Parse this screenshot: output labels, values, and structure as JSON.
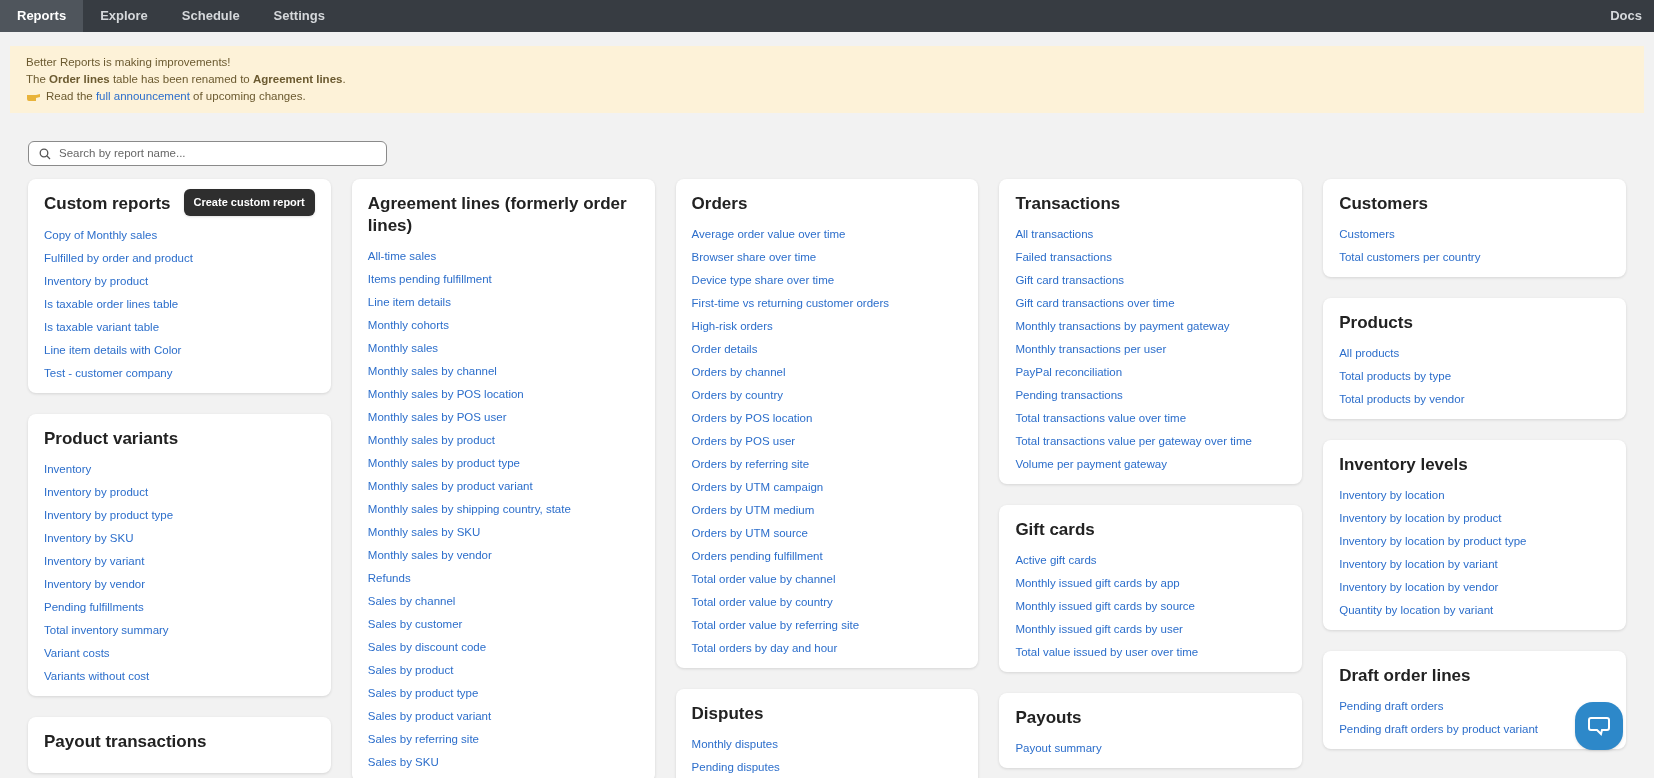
{
  "nav": {
    "tabs": [
      {
        "label": "Reports",
        "selected": true
      },
      {
        "label": "Explore",
        "selected": false
      },
      {
        "label": "Schedule",
        "selected": false
      },
      {
        "label": "Settings",
        "selected": false
      }
    ],
    "docs": "Docs"
  },
  "banner": {
    "line1": "Better Reports is making improvements!",
    "line2": "The **Order lines** table has been renamed to **Agreement lines**.",
    "line3_before": "Read the",
    "line3_link": "full announcement",
    "line3_after": "of upcoming changes."
  },
  "search": {
    "placeholder": "Search by report name..."
  },
  "columns": [
    [
      {
        "title": "Custom reports",
        "button": "Create custom report",
        "links": [
          "Copy of Monthly sales",
          "Fulfilled by order and product",
          "Inventory by product",
          "Is taxable order lines table",
          "Is taxable variant table",
          "Line item details with Color",
          "Test - customer company"
        ]
      },
      {
        "title": "Product variants",
        "links": [
          "Inventory",
          "Inventory by product",
          "Inventory by product type",
          "Inventory by SKU",
          "Inventory by variant",
          "Inventory by vendor",
          "Pending fulfillments",
          "Total inventory summary",
          "Variant costs",
          "Variants without cost"
        ]
      },
      {
        "title": "Payout transactions"
      }
    ],
    [
      {
        "title": "Agreement lines (formerly order lines)",
        "links": [
          "All-time sales",
          "Items pending fulfillment",
          "Line item details",
          "Monthly cohorts",
          "Monthly sales",
          "Monthly sales by channel",
          "Monthly sales by POS location",
          "Monthly sales by POS user",
          "Monthly sales by product",
          "Monthly sales by product type",
          "Monthly sales by product variant",
          "Monthly sales by shipping country, state",
          "Monthly sales by SKU",
          "Monthly sales by vendor",
          "Refunds",
          "Sales by channel",
          "Sales by customer",
          "Sales by discount code",
          "Sales by product",
          "Sales by product type",
          "Sales by product variant",
          "Sales by referring site",
          "Sales by SKU"
        ]
      }
    ],
    [
      {
        "title": "Orders",
        "links": [
          "Average order value over time",
          "Browser share over time",
          "Device type share over time",
          "First-time vs returning customer orders",
          "High-risk orders",
          "Order details",
          "Orders by channel",
          "Orders by country",
          "Orders by POS location",
          "Orders by POS user",
          "Orders by referring site",
          "Orders by UTM campaign",
          "Orders by UTM medium",
          "Orders by UTM source",
          "Orders pending fulfillment",
          "Total order value by channel",
          "Total order value by country",
          "Total order value by referring site",
          "Total orders by day and hour"
        ]
      },
      {
        "title": "Disputes",
        "links": [
          "Monthly disputes",
          "Pending disputes"
        ]
      }
    ],
    [
      {
        "title": "Transactions",
        "links": [
          "All transactions",
          "Failed transactions",
          "Gift card transactions",
          "Gift card transactions over time",
          "Monthly transactions by payment gateway",
          "Monthly transactions per user",
          "PayPal reconciliation",
          "Pending transactions",
          "Total transactions value over time",
          "Total transactions value per gateway over time",
          "Volume per payment gateway"
        ]
      },
      {
        "title": "Gift cards",
        "links": [
          "Active gift cards",
          "Monthly issued gift cards by app",
          "Monthly issued gift cards by source",
          "Monthly issued gift cards by user",
          "Total value issued by user over time"
        ]
      },
      {
        "title": "Payouts",
        "links": [
          "Payout summary"
        ]
      }
    ],
    [
      {
        "title": "Customers",
        "links": [
          "Customers",
          "Total customers per country"
        ]
      },
      {
        "title": "Products",
        "links": [
          "All products",
          "Total products by type",
          "Total products by vendor"
        ]
      },
      {
        "title": "Inventory levels",
        "links": [
          "Inventory by location",
          "Inventory by location by product",
          "Inventory by location by product type",
          "Inventory by location by variant",
          "Inventory by location by vendor",
          "Quantity by location by variant"
        ]
      },
      {
        "title": "Draft order lines",
        "links": [
          "Pending draft orders",
          "Pending draft orders by product variant"
        ]
      }
    ]
  ]
}
